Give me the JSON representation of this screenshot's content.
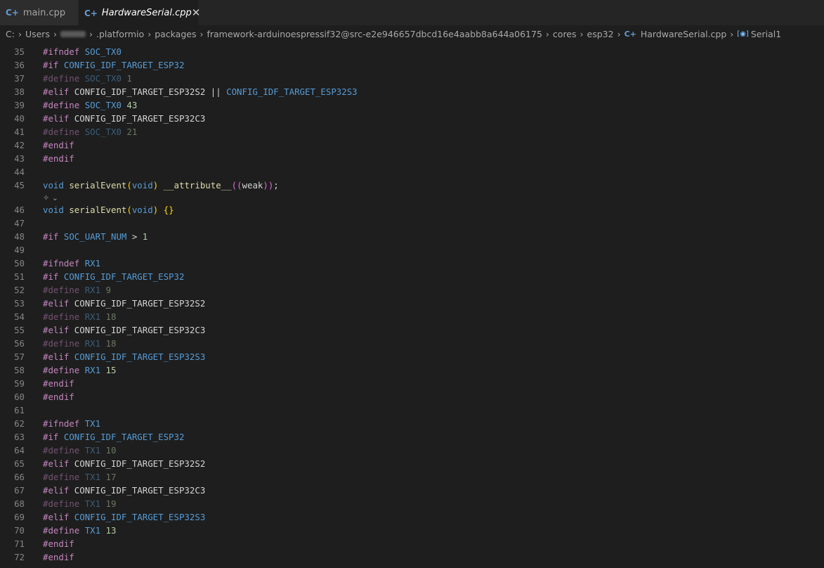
{
  "tabs": [
    {
      "label": "main.cpp",
      "icon": "c++-file-icon"
    },
    {
      "label": "HardwareSerial.cpp",
      "icon": "c++-file-icon",
      "close": "✕"
    }
  ],
  "breadcrumb": {
    "parts": [
      "C:",
      "Users",
      ".platformio",
      "packages",
      "framework-arduinoespressif32@src-e2e946657dbcd16e4aabb8a644a06175",
      "cores",
      "esp32",
      "HardwareSerial.cpp",
      "Serial1"
    ]
  },
  "lines": [
    {
      "n": "35",
      "tokens": [
        {
          "t": "#ifndef",
          "c": "pre"
        },
        {
          "t": " "
        },
        {
          "t": "SOC_TX0",
          "c": "macro"
        }
      ]
    },
    {
      "n": "36",
      "tokens": [
        {
          "t": "#if",
          "c": "pre"
        },
        {
          "t": " "
        },
        {
          "t": "CONFIG_IDF_TARGET_ESP32",
          "c": "macro"
        }
      ]
    },
    {
      "n": "37",
      "dim": true,
      "tokens": [
        {
          "t": "#define",
          "c": "pre"
        },
        {
          "t": " "
        },
        {
          "t": "SOC_TX0",
          "c": "macro"
        },
        {
          "t": " "
        },
        {
          "t": "1",
          "c": "num"
        }
      ]
    },
    {
      "n": "38",
      "tokens": [
        {
          "t": "#elif",
          "c": "pre"
        },
        {
          "t": " "
        },
        {
          "t": "CONFIG_IDF_TARGET_ESP32S2",
          "c": "plain"
        },
        {
          "t": " || "
        },
        {
          "t": "CONFIG_IDF_TARGET_ESP32S3",
          "c": "macro"
        }
      ]
    },
    {
      "n": "39",
      "tokens": [
        {
          "t": "#define",
          "c": "pre"
        },
        {
          "t": " "
        },
        {
          "t": "SOC_TX0",
          "c": "macro"
        },
        {
          "t": " "
        },
        {
          "t": "43",
          "c": "num"
        }
      ]
    },
    {
      "n": "40",
      "tokens": [
        {
          "t": "#elif",
          "c": "pre"
        },
        {
          "t": " "
        },
        {
          "t": "CONFIG_IDF_TARGET_ESP32C3",
          "c": "plain"
        }
      ]
    },
    {
      "n": "41",
      "dim": true,
      "tokens": [
        {
          "t": "#define",
          "c": "pre"
        },
        {
          "t": " "
        },
        {
          "t": "SOC_TX0",
          "c": "macro"
        },
        {
          "t": " "
        },
        {
          "t": "21",
          "c": "num"
        }
      ]
    },
    {
      "n": "42",
      "tokens": [
        {
          "t": "#endif",
          "c": "pre"
        }
      ]
    },
    {
      "n": "43",
      "tokens": [
        {
          "t": "#endif",
          "c": "pre"
        }
      ]
    },
    {
      "n": "44",
      "tokens": []
    },
    {
      "n": "45",
      "tokens": [
        {
          "t": "void",
          "c": "type"
        },
        {
          "t": " "
        },
        {
          "t": "serialEvent",
          "c": "fn"
        },
        {
          "t": "(",
          "c": "br1"
        },
        {
          "t": "void",
          "c": "type"
        },
        {
          "t": ")",
          "c": "br1"
        },
        {
          "t": " "
        },
        {
          "t": "__attribute__",
          "c": "attr"
        },
        {
          "t": "((",
          "c": "br2"
        },
        {
          "t": "weak",
          "c": "plain"
        },
        {
          "t": "))",
          "c": "br2"
        },
        {
          "t": ";"
        }
      ]
    },
    {
      "codelens": true
    },
    {
      "n": "46",
      "tokens": [
        {
          "t": "void",
          "c": "type"
        },
        {
          "t": " "
        },
        {
          "t": "serialEvent",
          "c": "fn"
        },
        {
          "t": "(",
          "c": "br1"
        },
        {
          "t": "void",
          "c": "type"
        },
        {
          "t": ")",
          "c": "br1"
        },
        {
          "t": " "
        },
        {
          "t": "{}",
          "c": "br1"
        }
      ]
    },
    {
      "n": "47",
      "tokens": []
    },
    {
      "n": "48",
      "tokens": [
        {
          "t": "#if",
          "c": "pre"
        },
        {
          "t": " "
        },
        {
          "t": "SOC_UART_NUM",
          "c": "macro"
        },
        {
          "t": " > "
        },
        {
          "t": "1",
          "c": "num"
        }
      ]
    },
    {
      "n": "49",
      "tokens": []
    },
    {
      "n": "50",
      "tokens": [
        {
          "t": "#ifndef",
          "c": "pre"
        },
        {
          "t": " "
        },
        {
          "t": "RX1",
          "c": "macro"
        }
      ]
    },
    {
      "n": "51",
      "tokens": [
        {
          "t": "#if",
          "c": "pre"
        },
        {
          "t": " "
        },
        {
          "t": "CONFIG_IDF_TARGET_ESP32",
          "c": "macro"
        }
      ]
    },
    {
      "n": "52",
      "dim": true,
      "tokens": [
        {
          "t": "#define",
          "c": "pre"
        },
        {
          "t": " "
        },
        {
          "t": "RX1",
          "c": "macro"
        },
        {
          "t": " "
        },
        {
          "t": "9",
          "c": "num"
        }
      ]
    },
    {
      "n": "53",
      "tokens": [
        {
          "t": "#elif",
          "c": "pre"
        },
        {
          "t": " "
        },
        {
          "t": "CONFIG_IDF_TARGET_ESP32S2",
          "c": "plain"
        }
      ]
    },
    {
      "n": "54",
      "dim": true,
      "tokens": [
        {
          "t": "#define",
          "c": "pre"
        },
        {
          "t": " "
        },
        {
          "t": "RX1",
          "c": "macro"
        },
        {
          "t": " "
        },
        {
          "t": "18",
          "c": "num"
        }
      ]
    },
    {
      "n": "55",
      "tokens": [
        {
          "t": "#elif",
          "c": "pre"
        },
        {
          "t": " "
        },
        {
          "t": "CONFIG_IDF_TARGET_ESP32C3",
          "c": "plain"
        }
      ]
    },
    {
      "n": "56",
      "dim": true,
      "tokens": [
        {
          "t": "#define",
          "c": "pre"
        },
        {
          "t": " "
        },
        {
          "t": "RX1",
          "c": "macro"
        },
        {
          "t": " "
        },
        {
          "t": "18",
          "c": "num"
        }
      ]
    },
    {
      "n": "57",
      "tokens": [
        {
          "t": "#elif",
          "c": "pre"
        },
        {
          "t": " "
        },
        {
          "t": "CONFIG_IDF_TARGET_ESP32S3",
          "c": "macro"
        }
      ]
    },
    {
      "n": "58",
      "tokens": [
        {
          "t": "#define",
          "c": "pre"
        },
        {
          "t": " "
        },
        {
          "t": "RX1",
          "c": "macro"
        },
        {
          "t": " "
        },
        {
          "t": "15",
          "c": "num"
        }
      ]
    },
    {
      "n": "59",
      "tokens": [
        {
          "t": "#endif",
          "c": "pre"
        }
      ]
    },
    {
      "n": "60",
      "tokens": [
        {
          "t": "#endif",
          "c": "pre"
        }
      ]
    },
    {
      "n": "61",
      "tokens": []
    },
    {
      "n": "62",
      "tokens": [
        {
          "t": "#ifndef",
          "c": "pre"
        },
        {
          "t": " "
        },
        {
          "t": "TX1",
          "c": "macro"
        }
      ]
    },
    {
      "n": "63",
      "tokens": [
        {
          "t": "#if",
          "c": "pre"
        },
        {
          "t": " "
        },
        {
          "t": "CONFIG_IDF_TARGET_ESP32",
          "c": "macro"
        }
      ]
    },
    {
      "n": "64",
      "dim": true,
      "tokens": [
        {
          "t": "#define",
          "c": "pre"
        },
        {
          "t": " "
        },
        {
          "t": "TX1",
          "c": "macro"
        },
        {
          "t": " "
        },
        {
          "t": "10",
          "c": "num"
        }
      ]
    },
    {
      "n": "65",
      "tokens": [
        {
          "t": "#elif",
          "c": "pre"
        },
        {
          "t": " "
        },
        {
          "t": "CONFIG_IDF_TARGET_ESP32S2",
          "c": "plain"
        }
      ]
    },
    {
      "n": "66",
      "dim": true,
      "tokens": [
        {
          "t": "#define",
          "c": "pre"
        },
        {
          "t": " "
        },
        {
          "t": "TX1",
          "c": "macro"
        },
        {
          "t": " "
        },
        {
          "t": "17",
          "c": "num"
        }
      ]
    },
    {
      "n": "67",
      "tokens": [
        {
          "t": "#elif",
          "c": "pre"
        },
        {
          "t": " "
        },
        {
          "t": "CONFIG_IDF_TARGET_ESP32C3",
          "c": "plain"
        }
      ]
    },
    {
      "n": "68",
      "dim": true,
      "tokens": [
        {
          "t": "#define",
          "c": "pre"
        },
        {
          "t": " "
        },
        {
          "t": "TX1",
          "c": "macro"
        },
        {
          "t": " "
        },
        {
          "t": "19",
          "c": "num"
        }
      ]
    },
    {
      "n": "69",
      "tokens": [
        {
          "t": "#elif",
          "c": "pre"
        },
        {
          "t": " "
        },
        {
          "t": "CONFIG_IDF_TARGET_ESP32S3",
          "c": "macro"
        }
      ]
    },
    {
      "n": "70",
      "tokens": [
        {
          "t": "#define",
          "c": "pre"
        },
        {
          "t": " "
        },
        {
          "t": "TX1",
          "c": "macro"
        },
        {
          "t": " "
        },
        {
          "t": "13",
          "c": "num"
        }
      ]
    },
    {
      "n": "71",
      "tokens": [
        {
          "t": "#endif",
          "c": "pre"
        }
      ]
    },
    {
      "n": "72",
      "tokens": [
        {
          "t": "#endif",
          "c": "pre"
        }
      ]
    }
  ]
}
